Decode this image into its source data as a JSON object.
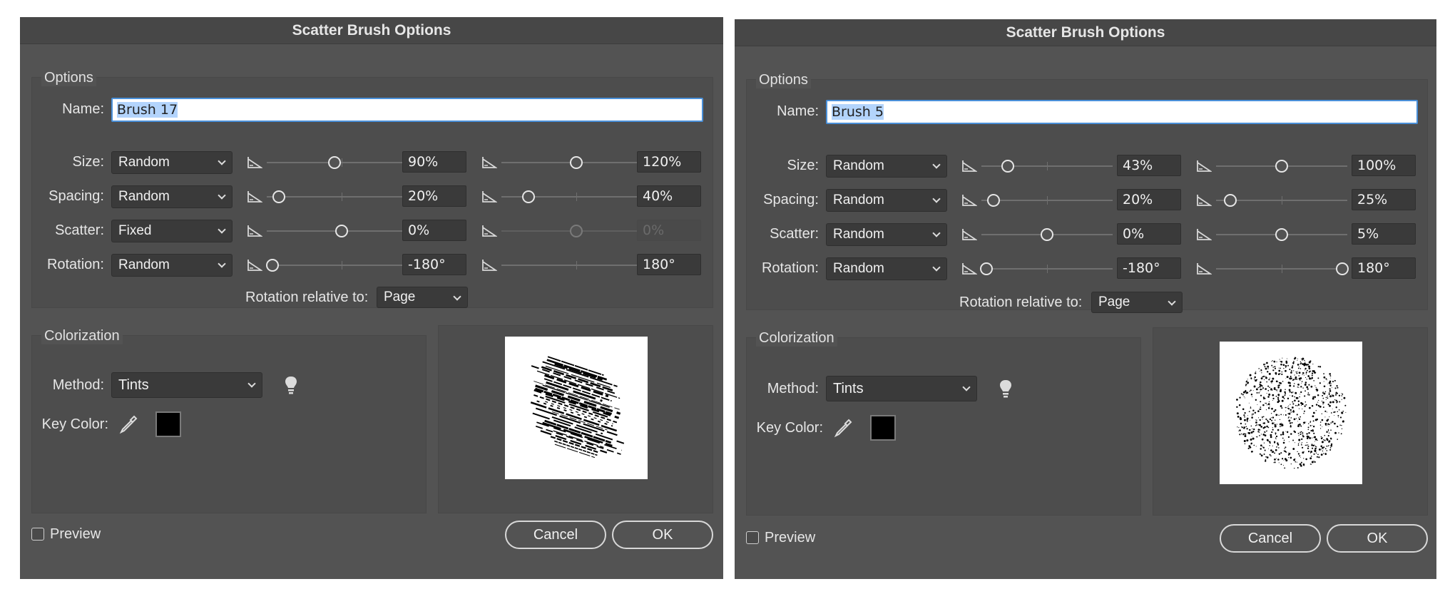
{
  "dialogs": [
    {
      "title": "Scatter Brush Options",
      "options_legend": "Options",
      "name_label": "Name:",
      "name_value": "Brush 17",
      "rows": [
        {
          "label": "Size:",
          "mode": "Random",
          "min_value": "90%",
          "max_value": "120%",
          "min_thumb": 0.45,
          "max_thumb": 0.5,
          "max_disabled": false
        },
        {
          "label": "Spacing:",
          "mode": "Random",
          "min_value": "20%",
          "max_value": "40%",
          "min_thumb": 0.08,
          "max_thumb": 0.18,
          "max_disabled": false
        },
        {
          "label": "Scatter:",
          "mode": "Fixed",
          "min_value": "0%",
          "max_value": "0%",
          "min_thumb": 0.5,
          "max_thumb": 0.5,
          "max_disabled": true
        },
        {
          "label": "Rotation:",
          "mode": "Random",
          "min_value": "-180°",
          "max_value": "180°",
          "min_thumb": 0.04,
          "max_thumb": 0.96,
          "max_disabled": false
        }
      ],
      "rotation_relative_label": "Rotation relative to:",
      "rotation_relative_value": "Page",
      "colorization_legend": "Colorization",
      "method_label": "Method:",
      "method_value": "Tints",
      "key_color_label": "Key Color:",
      "key_color": "#000000",
      "preview_label": "Preview",
      "cancel_label": "Cancel",
      "ok_label": "OK"
    },
    {
      "title": "Scatter Brush Options",
      "options_legend": "Options",
      "name_label": "Name:",
      "name_value": "Brush 5",
      "rows": [
        {
          "label": "Size:",
          "mode": "Random",
          "min_value": "43%",
          "max_value": "100%",
          "min_thumb": 0.2,
          "max_thumb": 0.5,
          "max_disabled": false
        },
        {
          "label": "Spacing:",
          "mode": "Random",
          "min_value": "20%",
          "max_value": "25%",
          "min_thumb": 0.09,
          "max_thumb": 0.11,
          "max_disabled": false
        },
        {
          "label": "Scatter:",
          "mode": "Random",
          "min_value": "0%",
          "max_value": "5%",
          "min_thumb": 0.5,
          "max_thumb": 0.5,
          "max_disabled": false
        },
        {
          "label": "Rotation:",
          "mode": "Random",
          "min_value": "-180°",
          "max_value": "180°",
          "min_thumb": 0.04,
          "max_thumb": 0.96,
          "max_disabled": false
        }
      ],
      "rotation_relative_label": "Rotation relative to:",
      "rotation_relative_value": "Page",
      "colorization_legend": "Colorization",
      "method_label": "Method:",
      "method_value": "Tints",
      "key_color_label": "Key Color:",
      "key_color": "#000000",
      "preview_label": "Preview",
      "cancel_label": "Cancel",
      "ok_label": "OK"
    }
  ]
}
